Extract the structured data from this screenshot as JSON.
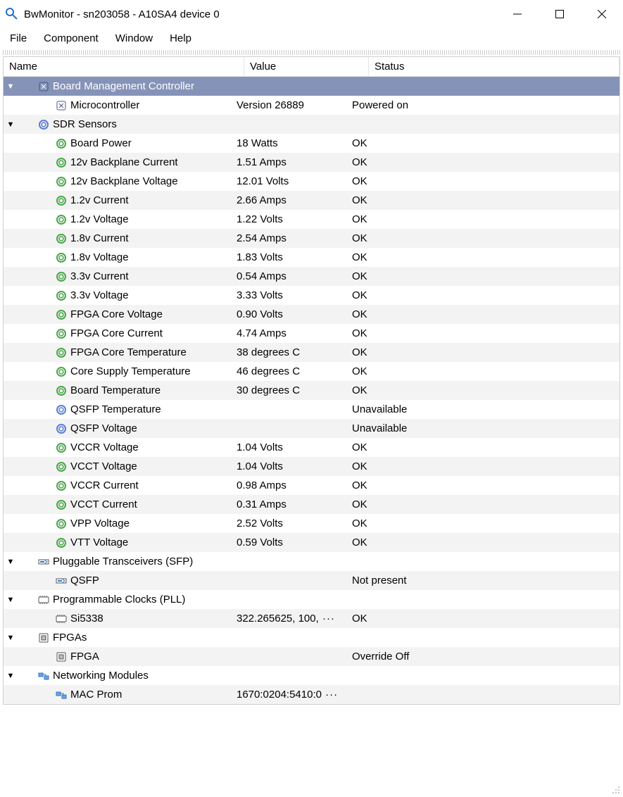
{
  "window": {
    "title": "BwMonitor - sn203058 - A10SA4 device 0"
  },
  "menu": {
    "file": "File",
    "component": "Component",
    "window": "Window",
    "help": "Help"
  },
  "columns": {
    "name": "Name",
    "value": "Value",
    "status": "Status"
  },
  "rows": {
    "bmc": {
      "name": "Board Management Controller",
      "value": "",
      "status": ""
    },
    "microcontroller": {
      "name": "Microcontroller",
      "value": "Version 26889",
      "status": "Powered on"
    },
    "sdr": {
      "name": "SDR Sensors",
      "value": "",
      "status": ""
    },
    "boardpower": {
      "name": "Board Power",
      "value": "18 Watts",
      "status": "OK"
    },
    "bp12c": {
      "name": "12v Backplane Current",
      "value": "1.51 Amps",
      "status": "OK"
    },
    "bp12v": {
      "name": "12v Backplane Voltage",
      "value": "12.01 Volts",
      "status": "OK"
    },
    "v12c": {
      "name": "1.2v Current",
      "value": "2.66 Amps",
      "status": "OK"
    },
    "v12v": {
      "name": "1.2v Voltage",
      "value": "1.22 Volts",
      "status": "OK"
    },
    "v18c": {
      "name": "1.8v Current",
      "value": "2.54 Amps",
      "status": "OK"
    },
    "v18v": {
      "name": "1.8v Voltage",
      "value": "1.83 Volts",
      "status": "OK"
    },
    "v33c": {
      "name": "3.3v Current",
      "value": "0.54 Amps",
      "status": "OK"
    },
    "v33v": {
      "name": "3.3v Voltage",
      "value": "3.33 Volts",
      "status": "OK"
    },
    "fpgacv": {
      "name": "FPGA Core Voltage",
      "value": "0.90 Volts",
      "status": "OK"
    },
    "fpgacc": {
      "name": "FPGA Core Current",
      "value": "4.74 Amps",
      "status": "OK"
    },
    "fpgact": {
      "name": "FPGA Core Temperature",
      "value": "38 degrees C",
      "status": "OK"
    },
    "cst": {
      "name": "Core Supply Temperature",
      "value": "46 degrees C",
      "status": "OK"
    },
    "bt": {
      "name": "Board Temperature",
      "value": "30 degrees C",
      "status": "OK"
    },
    "qsfpt": {
      "name": "QSFP Temperature",
      "value": "",
      "status": "Unavailable"
    },
    "qsfpv": {
      "name": "QSFP Voltage",
      "value": "",
      "status": "Unavailable"
    },
    "vccrv": {
      "name": "VCCR Voltage",
      "value": "1.04 Volts",
      "status": "OK"
    },
    "vcctv": {
      "name": "VCCT Voltage",
      "value": "1.04 Volts",
      "status": "OK"
    },
    "vccrc": {
      "name": "VCCR Current",
      "value": "0.98 Amps",
      "status": "OK"
    },
    "vcctc": {
      "name": "VCCT Current",
      "value": "0.31 Amps",
      "status": "OK"
    },
    "vppv": {
      "name": "VPP Voltage",
      "value": "2.52 Volts",
      "status": "OK"
    },
    "vttv": {
      "name": "VTT Voltage",
      "value": "0.59 Volts",
      "status": "OK"
    },
    "sfp": {
      "name": "Pluggable Transceivers (SFP)",
      "value": "",
      "status": ""
    },
    "qsfp": {
      "name": "QSFP",
      "value": "",
      "status": "Not present"
    },
    "pll": {
      "name": "Programmable Clocks (PLL)",
      "value": "",
      "status": ""
    },
    "si5338": {
      "name": "Si5338",
      "value": "322.265625, 100,",
      "status": "OK"
    },
    "fpgas": {
      "name": "FPGAs",
      "value": "",
      "status": ""
    },
    "fpga": {
      "name": "FPGA",
      "value": "",
      "status": "Override Off"
    },
    "net": {
      "name": "Networking Modules",
      "value": "",
      "status": ""
    },
    "macprom": {
      "name": "MAC Prom",
      "value": "1670:0204:5410:0",
      "status": ""
    }
  }
}
